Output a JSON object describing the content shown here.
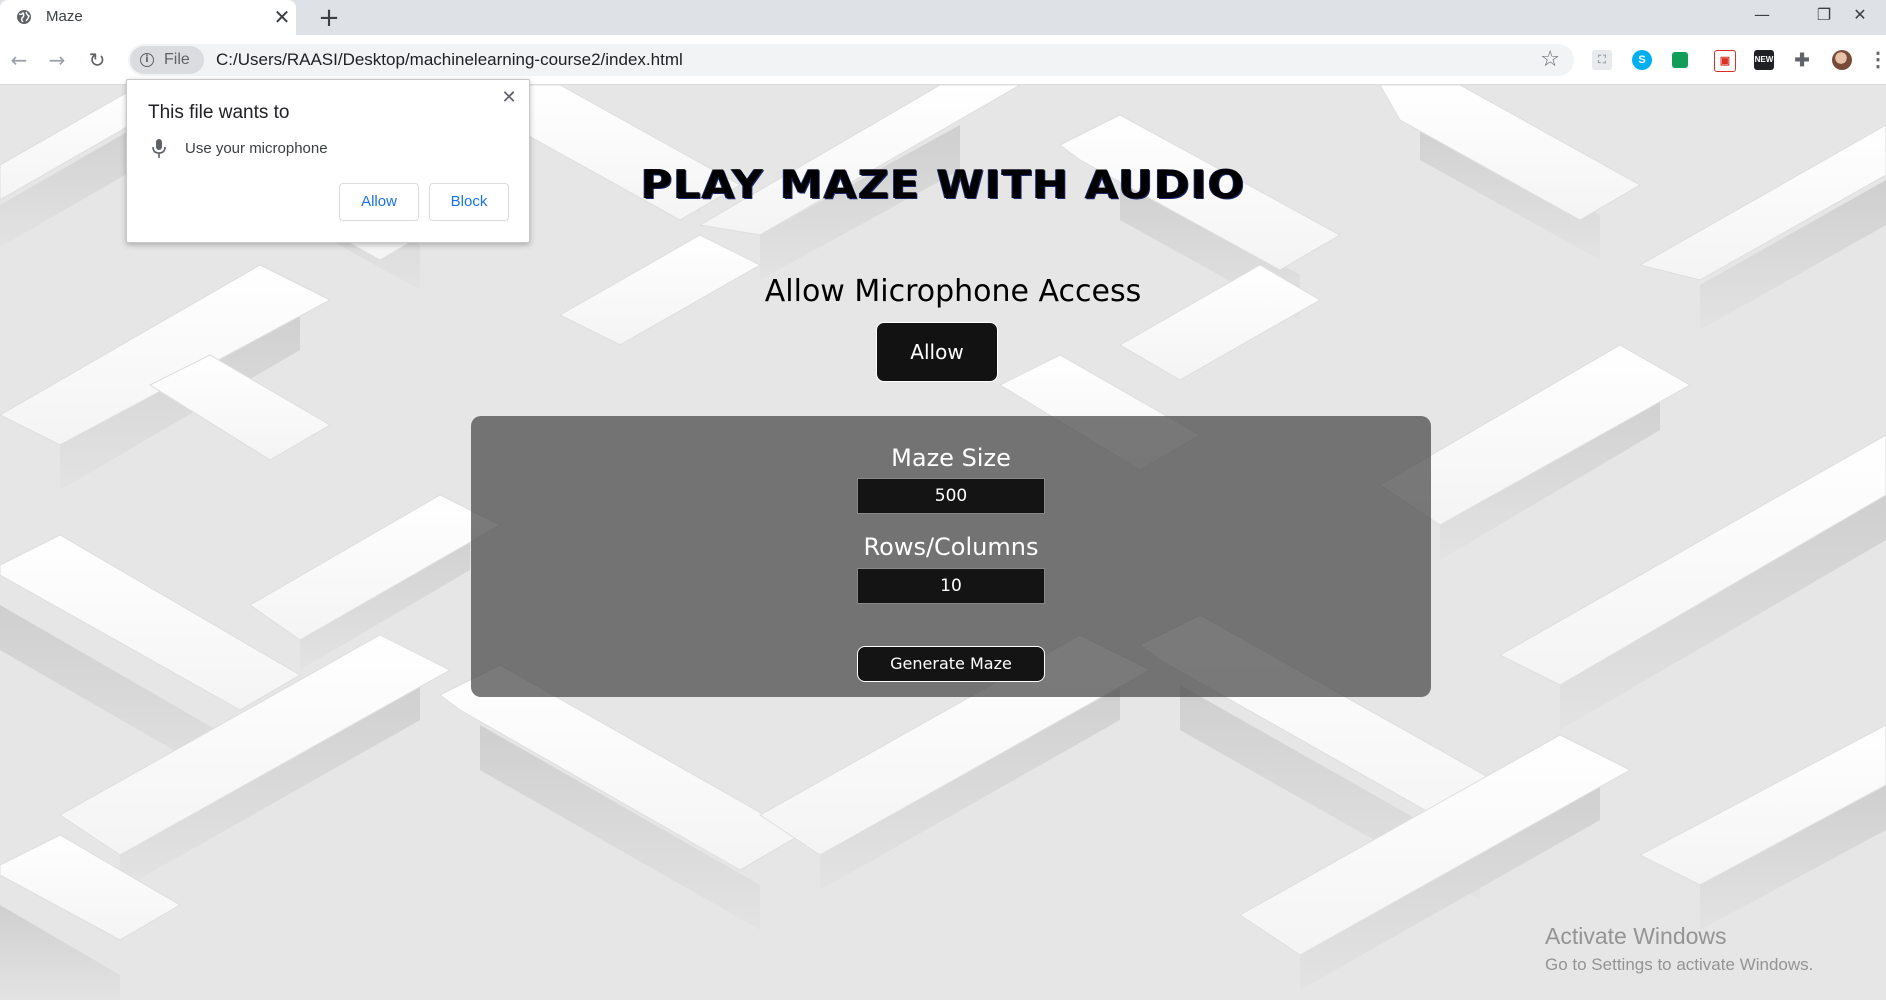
{
  "browser": {
    "tab_title": "Maze",
    "tab_close": "✕",
    "new_tab": "+",
    "window_controls": {
      "minimize": "—",
      "restore": "❐",
      "close": "✕"
    },
    "security_chip": "File",
    "url": "C:/Users/RAASI/Desktop/machinelearning-course2/index.html",
    "bookmark_icon": "star-icon",
    "extensions": [
      {
        "name": "pdf-extension-icon",
        "glyph": "⛶",
        "color": "#9aa0a6"
      },
      {
        "name": "skype-extension-icon",
        "glyph": "S",
        "color": "#00aff0"
      },
      {
        "name": "sheets-extension-icon",
        "glyph": "▦",
        "color": "#0f9d58"
      },
      {
        "name": "clipboard-extension-icon",
        "glyph": "▣",
        "color": "#d93025"
      },
      {
        "name": "new-extension-icon",
        "glyph": "NEW",
        "color": "#202124"
      },
      {
        "name": "puzzle-extension-icon",
        "glyph": "✚",
        "color": "#5f6368"
      }
    ],
    "menu_glyph": "⋮"
  },
  "permission_popup": {
    "title": "This file wants to",
    "item": "Use your microphone",
    "allow_label": "Allow",
    "block_label": "Block",
    "close": "✕"
  },
  "page": {
    "title": "PLAY MAZE WITH AUDIO",
    "mic_heading": "Allow Microphone Access",
    "allow_label": "Allow",
    "maze_size_label": "Maze Size",
    "maze_size_value": "500",
    "rows_columns_label": "Rows/Columns",
    "rows_columns_value": "10",
    "generate_label": "Generate Maze"
  },
  "watermark": {
    "line1": "Activate Windows",
    "line2": "Go to Settings to activate Windows."
  },
  "colors": {
    "accent_link": "#1a73e8",
    "button_dark": "#121212",
    "panel": "rgba(70,70,70,0.72)"
  }
}
